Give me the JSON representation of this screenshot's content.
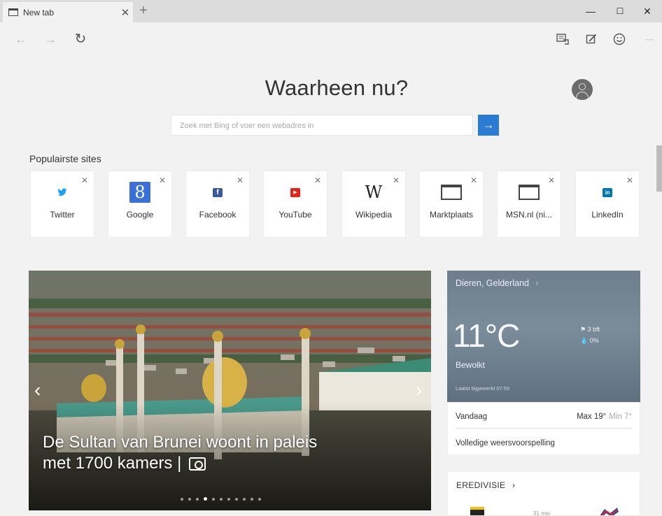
{
  "window": {
    "tab_title": "New tab",
    "tab_close": "✕",
    "new_tab": "+",
    "minimize": "—",
    "maximize": "☐",
    "close": "✕"
  },
  "nav": {
    "back_icon": "←",
    "forward_icon": "→",
    "refresh_icon": "↻"
  },
  "toolbar": {
    "reading_view_icon": "reading-view-icon",
    "web_note_icon": "web-note-icon",
    "feedback_icon": "smiley-icon",
    "more": "···"
  },
  "page": {
    "heading": "Waarheen nu?"
  },
  "search": {
    "placeholder": "Zoek met Bing of voer een webadres in",
    "go_icon": "→"
  },
  "top_sites": {
    "heading": "Populairste sites",
    "close_glyph": "✕",
    "tiles": [
      {
        "label": "Twitter",
        "icon": "twitter-icon",
        "color": "#1da1f2",
        "glyph": "🐦"
      },
      {
        "label": "Google",
        "icon": "google-icon",
        "color": "#3a6fd8",
        "glyph": "8"
      },
      {
        "label": "Facebook",
        "icon": "facebook-icon",
        "color": "#3b5998",
        "glyph": "f"
      },
      {
        "label": "YouTube",
        "icon": "youtube-icon",
        "color": "#e62117",
        "glyph": "▶"
      },
      {
        "label": "Wikipedia",
        "icon": "wikipedia-icon",
        "color": "#222222",
        "glyph": "W"
      },
      {
        "label": "Marktplaats",
        "icon": "window-icon",
        "color": "#444444",
        "glyph": ""
      },
      {
        "label": "MSN.nl (ni...",
        "icon": "window-icon",
        "color": "#444444",
        "glyph": ""
      },
      {
        "label": "LinkedIn",
        "icon": "linkedin-icon",
        "color": "#0077b5",
        "glyph": "in"
      }
    ]
  },
  "hero": {
    "caption_line1": "De Sultan van Brunei woont in paleis",
    "caption_line2": "met 1700 kamers |",
    "prev": "‹",
    "next": "›",
    "dots_total": 11,
    "dots_active": 4
  },
  "weather": {
    "location": "Dieren, Gelderland",
    "location_chevron": "›",
    "temperature": "11°C",
    "wind": "3 bft",
    "precipitation": "0%",
    "condition": "Bewolkt",
    "updated": "Laatst bijgewerkt 07:55",
    "today_label": "Vandaag",
    "max": "Max 19°",
    "min": "Min 7°",
    "full_forecast": "Volledige weersvoorspelling"
  },
  "sports": {
    "title": "EREDIVISIE",
    "chevron": "›",
    "date": "31 mei"
  }
}
